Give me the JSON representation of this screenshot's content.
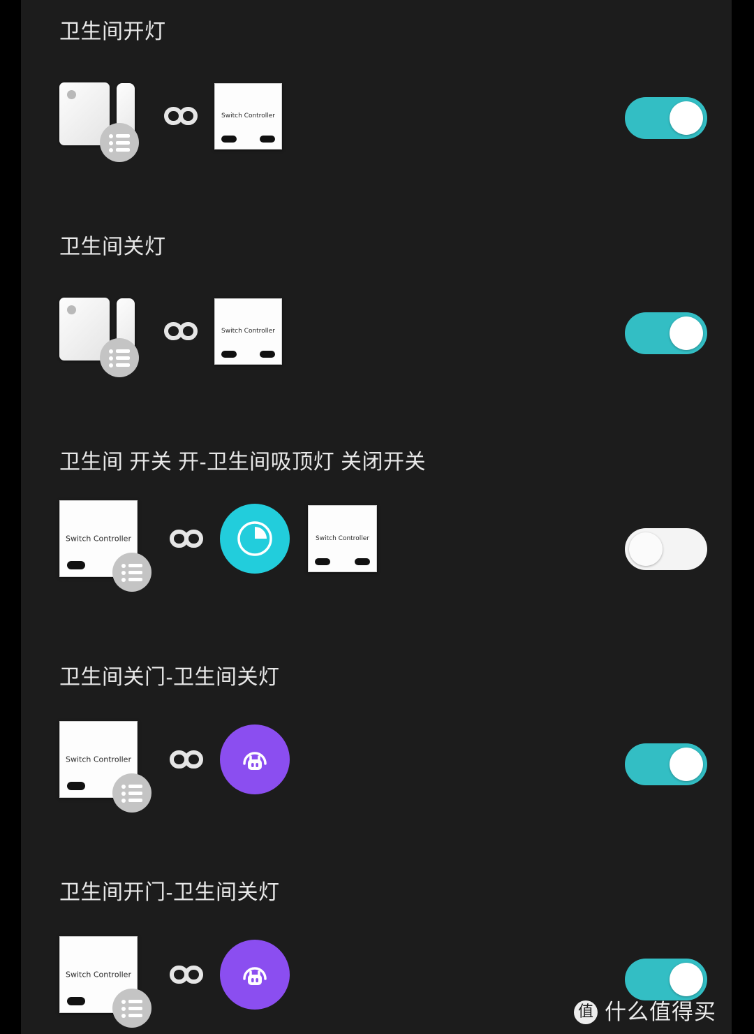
{
  "theme": {
    "page_background": "#000000",
    "panel_background": "#1c1c1c",
    "title_color": "#e8e8e8",
    "toggle_on_color": "#33bec4",
    "toggle_off_color": "#f4f4f4",
    "timer_circle_color": "#22cddc",
    "robot_circle_color": "#8b4ef0",
    "badge_color": "#c4c4c4"
  },
  "rules": [
    {
      "title": "卫生间开灯",
      "toggle": {
        "state": "on",
        "label": "on"
      },
      "nodes": [
        {
          "type": "door-sensor",
          "badge": "list"
        },
        {
          "type": "link"
        },
        {
          "type": "switch-controller",
          "label": "Switch Controller",
          "pills": 2
        }
      ]
    },
    {
      "title": "卫生间关灯",
      "toggle": {
        "state": "on",
        "label": "on"
      },
      "nodes": [
        {
          "type": "door-sensor",
          "badge": "list"
        },
        {
          "type": "link"
        },
        {
          "type": "switch-controller",
          "label": "Switch Controller",
          "pills": 2
        }
      ]
    },
    {
      "title": "卫生间 开关 开-卫生间吸顶灯 关闭开关",
      "toggle": {
        "state": "off",
        "label": "off"
      },
      "nodes": [
        {
          "type": "switch-controller",
          "label": "Switch Controller",
          "pills": 1,
          "badge": "list"
        },
        {
          "type": "link"
        },
        {
          "type": "timer-circle"
        },
        {
          "type": "switch-controller",
          "label": "Switch Controller",
          "pills": 2
        }
      ]
    },
    {
      "title": "卫生间关门-卫生间关灯",
      "toggle": {
        "state": "on",
        "label": "on"
      },
      "nodes": [
        {
          "type": "switch-controller",
          "label": "Switch Controller",
          "pills": 1,
          "badge": "list"
        },
        {
          "type": "link"
        },
        {
          "type": "robot-circle"
        }
      ]
    },
    {
      "title": "卫生间开门-卫生间关灯",
      "toggle": {
        "state": "on",
        "label": "on"
      },
      "nodes": [
        {
          "type": "switch-controller",
          "label": "Switch Controller",
          "pills": 1,
          "badge": "list"
        },
        {
          "type": "link"
        },
        {
          "type": "robot-circle"
        }
      ]
    }
  ],
  "watermark": {
    "badge": "值",
    "text": "什么值得买"
  }
}
